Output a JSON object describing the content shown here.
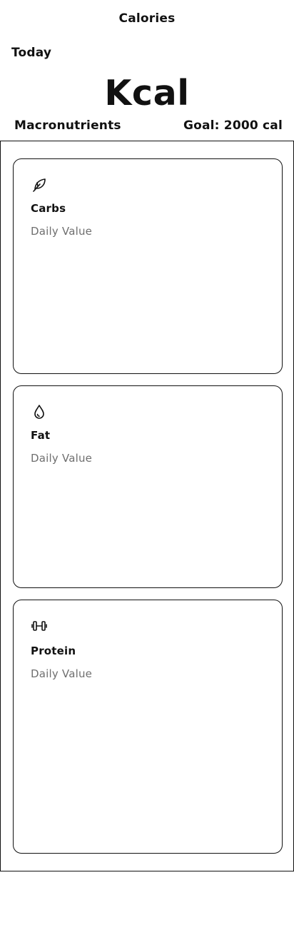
{
  "header": {
    "title": "Calories"
  },
  "day_label": "Today",
  "kcal_label": "Kcal",
  "macronutrients": {
    "label": "Macronutrients",
    "goal": "Goal: 2000 cal"
  },
  "cards": [
    {
      "icon": "leaf-icon",
      "title": "Carbs",
      "subtitle": "Daily Value"
    },
    {
      "icon": "droplet-icon",
      "title": "Fat",
      "subtitle": "Daily Value"
    },
    {
      "icon": "dumbbell-icon",
      "title": "Protein",
      "subtitle": "Daily Value"
    }
  ]
}
